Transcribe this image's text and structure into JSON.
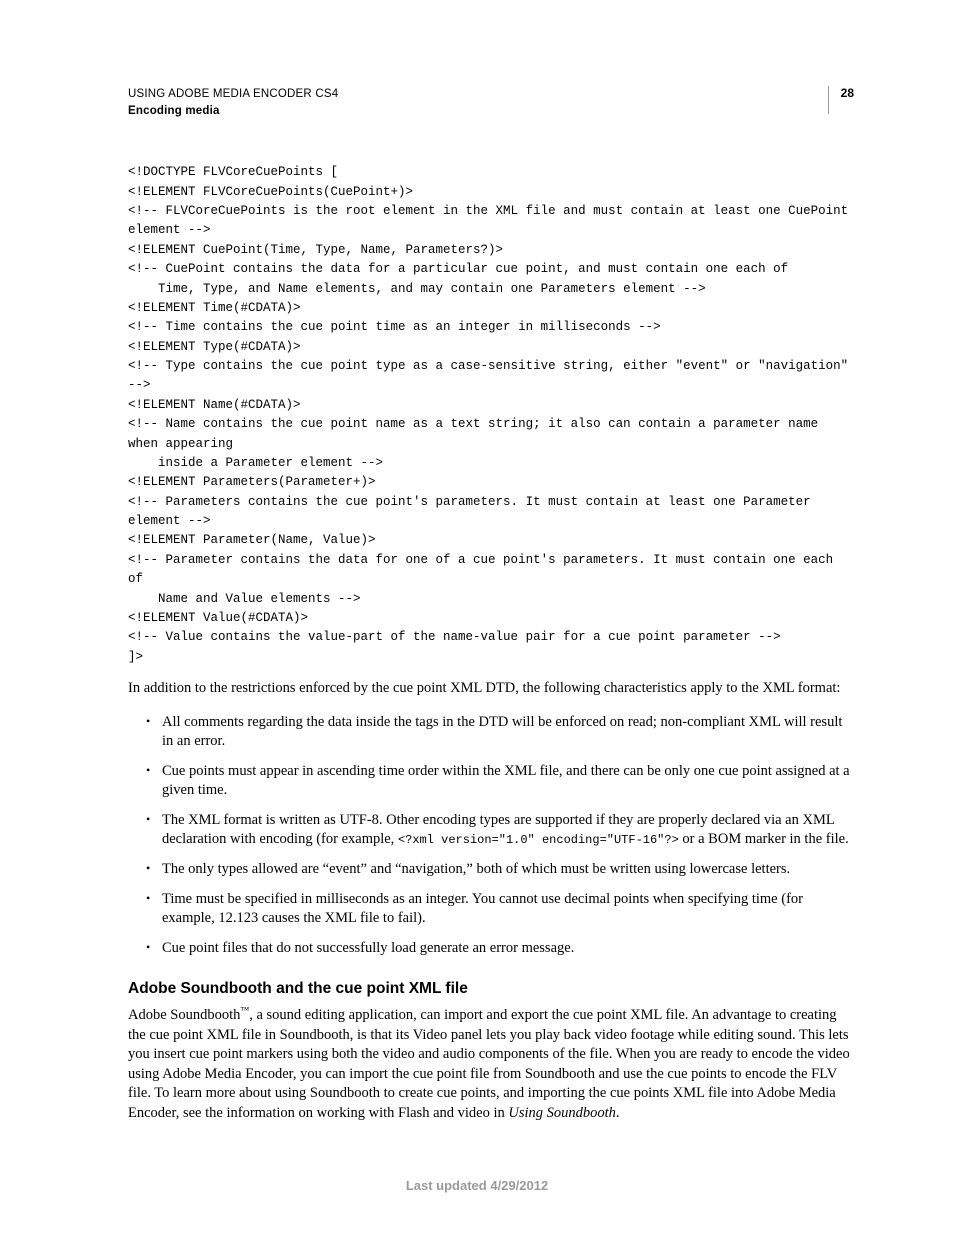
{
  "header": {
    "title": "USING ADOBE MEDIA ENCODER CS4",
    "subtitle": "Encoding media",
    "page_number": "28"
  },
  "code_block": "<!DOCTYPE FLVCoreCuePoints [\n<!ELEMENT FLVCoreCuePoints(CuePoint+)>\n<!-- FLVCoreCuePoints is the root element in the XML file and must contain at least one CuePoint element -->\n<!ELEMENT CuePoint(Time, Type, Name, Parameters?)>\n<!-- CuePoint contains the data for a particular cue point, and must contain one each of\n    Time, Type, and Name elements, and may contain one Parameters element -->\n<!ELEMENT Time(#CDATA)>\n<!-- Time contains the cue point time as an integer in milliseconds -->\n<!ELEMENT Type(#CDATA)>\n<!-- Type contains the cue point type as a case-sensitive string, either \"event\" or \"navigation\" -->\n<!ELEMENT Name(#CDATA)>\n<!-- Name contains the cue point name as a text string; it also can contain a parameter name when appearing\n    inside a Parameter element -->\n<!ELEMENT Parameters(Parameter+)>\n<!-- Parameters contains the cue point's parameters. It must contain at least one Parameter element -->\n<!ELEMENT Parameter(Name, Value)>\n<!-- Parameter contains the data for one of a cue point's parameters. It must contain one each of\n    Name and Value elements -->\n<!ELEMENT Value(#CDATA)>\n<!-- Value contains the value-part of the name-value pair for a cue point parameter -->\n]>",
  "intro_paragraph": "In addition to the restrictions enforced by the cue point XML DTD, the following characteristics apply to the XML format:",
  "bullets": [
    {
      "text": "All comments regarding the data inside the tags in the DTD will be enforced on read; non-compliant XML will result in an error."
    },
    {
      "text": "Cue points must appear in ascending time order within the XML file, and there can be only one cue point assigned at a given time."
    },
    {
      "pre": "The XML format is written as UTF-8. Other encoding types are supported if they are properly declared via an XML declaration with encoding (for example, ",
      "code": "<?xml version=\"1.0\" encoding=\"UTF-16\"?>",
      "post": " or a BOM marker in the file."
    },
    {
      "text": "The only types allowed are “event” and “navigation,” both of which must be written using lowercase letters."
    },
    {
      "text": "Time must be specified in milliseconds as an integer. You cannot use decimal points when specifying time (for example, 12.123 causes the XML file to fail)."
    },
    {
      "text": "Cue point files that do not successfully load generate an error message."
    }
  ],
  "section": {
    "heading": "Adobe Soundbooth and the cue point XML file",
    "body_pre": "Adobe Soundbooth",
    "tm": "™",
    "body_mid": ", a sound editing application, can import and export the cue point XML file. An advantage to creating the cue point XML file in Soundbooth, is that its Video panel lets you play back video footage while editing sound. This lets you insert cue point markers using both the video and audio components of the file. When you are ready to encode the video using Adobe Media Encoder, you can import the cue point file from Soundbooth and use the cue points to encode the FLV file. To learn more about using Soundbooth to create cue points, and importing the cue points XML file into Adobe Media Encoder, see the information on working with Flash and video in ",
    "body_italic": "Using Soundbooth",
    "body_post": "."
  },
  "footer": "Last updated 4/29/2012"
}
